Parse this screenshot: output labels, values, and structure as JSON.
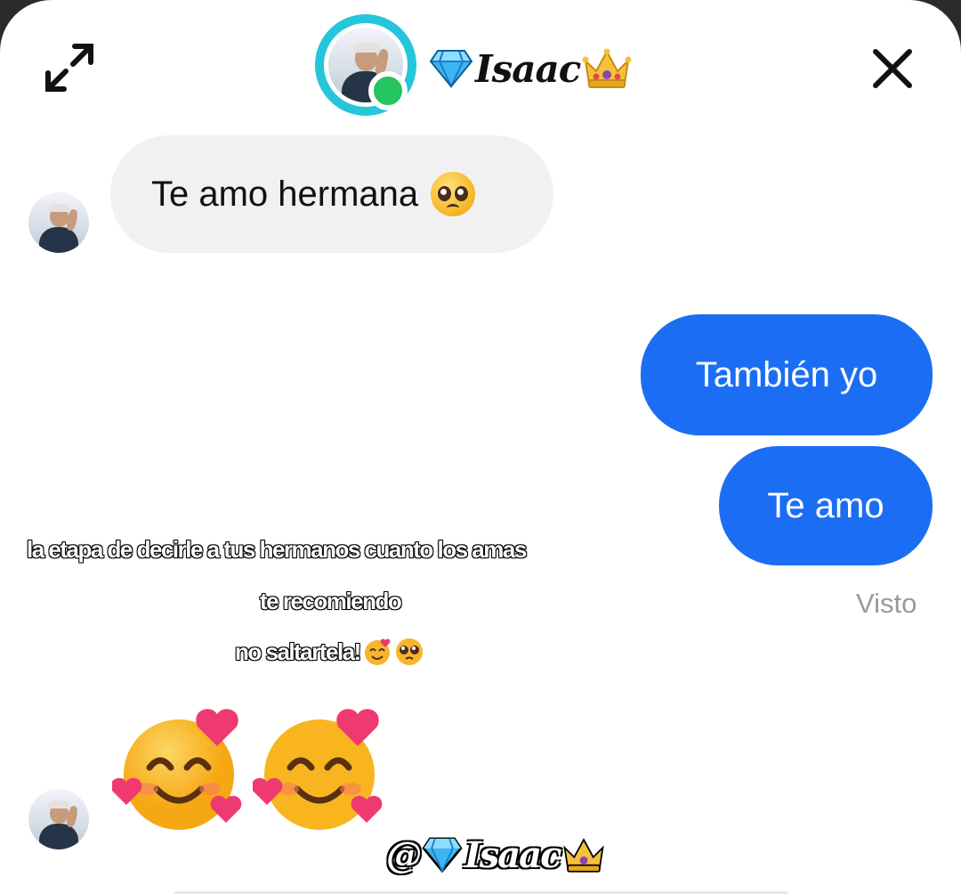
{
  "header": {
    "contact_name": "Isaac",
    "expand_icon": "expand-arrows-icon",
    "close_icon": "close-x-icon",
    "online_status_color": "#22c55e",
    "avatar_ring_color": "#25c6d9"
  },
  "messages": [
    {
      "direction": "incoming",
      "text": "Te amo hermana",
      "emoji": "pleading-face-icon"
    },
    {
      "direction": "outgoing",
      "text": "También yo"
    },
    {
      "direction": "outgoing",
      "text": "Te amo"
    },
    {
      "direction": "incoming",
      "emoji_only": [
        "smiling-face-with-hearts-icon",
        "smiling-face-with-hearts-icon"
      ]
    }
  ],
  "read_receipt": "Visto",
  "caption": {
    "line1": "la etapa de decirle a tus hermanos cuanto los amas",
    "line2": "te recomiendo",
    "line3": "no saltartela!"
  },
  "watermark": {
    "prefix": "@",
    "name": "Isaac"
  },
  "colors": {
    "outgoing_bubble": "#1b6ef3",
    "incoming_bubble": "#f1f1f1"
  }
}
